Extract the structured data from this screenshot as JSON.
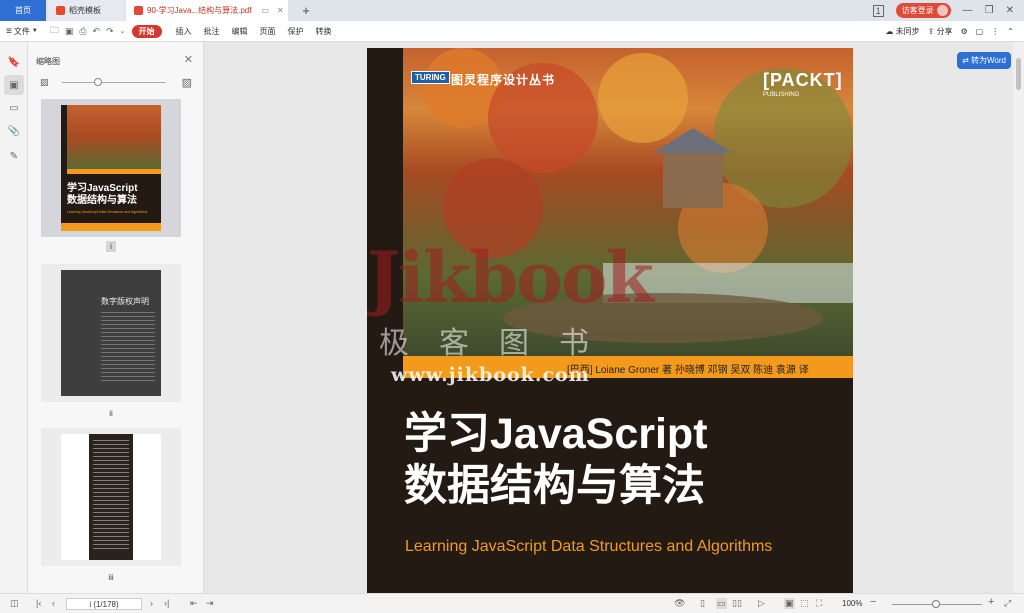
{
  "tabs": {
    "home": "首页",
    "template": "稻壳模板",
    "pdf": "90-学习Java...结构与算法.pdf"
  },
  "header": {
    "visitor_login": "访客登录"
  },
  "toolbar": {
    "file": "文件",
    "start": "开始",
    "insert": "插入",
    "annotate": "批注",
    "edit": "编辑",
    "page": "页面",
    "protect": "保护",
    "convert": "转换",
    "not_synced": "未同步",
    "share": "分享"
  },
  "thumbnails": {
    "title": "缩略图",
    "pages": [
      {
        "label": "i",
        "cn_title": "学习JavaScript\n数据结构与算法",
        "en_title": "Learning JavaScript Data Structures and Algorithms"
      },
      {
        "label": "ii",
        "heading": "数字版权声明"
      },
      {
        "label": "iii"
      }
    ]
  },
  "convert_to_word": "转为Word",
  "book": {
    "series": "图灵程序设计丛书",
    "turing": "TURING",
    "publisher": "[PACKT]",
    "publisher_sub": "PUBLISHING",
    "authors": "[巴西] Loiane Groner 著    孙晓博 邓钢 吴双 陈迪 袁源 译",
    "cn_title_line1": "学习JavaScript",
    "cn_title_line2": "数据结构与算法",
    "en_title": "Learning JavaScript Data Structures and Algorithms"
  },
  "watermark": {
    "big": "Jikbook",
    "cn": "极客图书",
    "url": "www.jikbook.com"
  },
  "statusbar": {
    "page_indicator": "i (1/178)",
    "zoom": "100%"
  },
  "colors": {
    "accent": "#2f6fd4",
    "start": "#d33a2b",
    "orange": "#f39a1c",
    "cover_dark": "#241a14"
  }
}
